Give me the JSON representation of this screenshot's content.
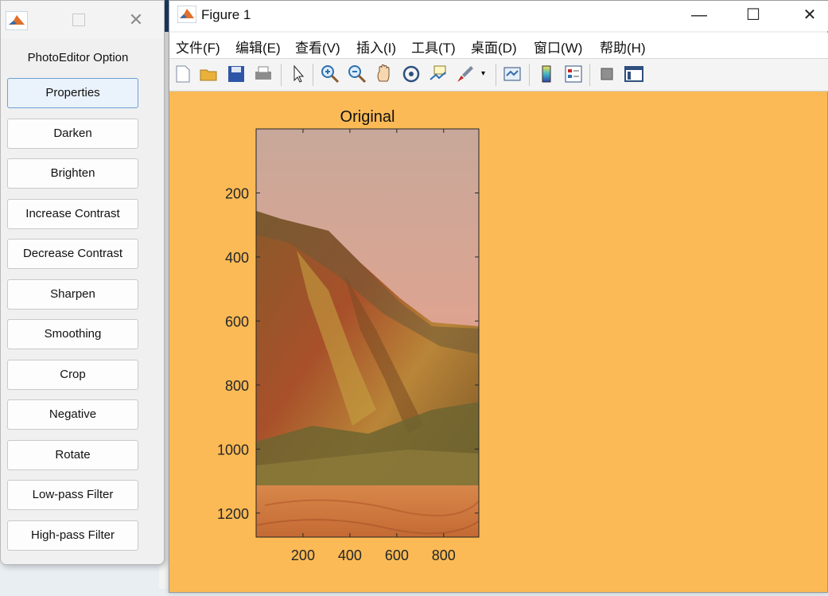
{
  "tool_window": {
    "heading": "PhotoEditor Option",
    "buttons": [
      {
        "label": "Properties"
      },
      {
        "label": "Darken"
      },
      {
        "label": "Brighten"
      },
      {
        "label": "Increase Contrast"
      },
      {
        "label": "Decrease Contrast"
      },
      {
        "label": "Sharpen"
      },
      {
        "label": "Smoothing"
      },
      {
        "label": "Crop"
      },
      {
        "label": "Negative"
      },
      {
        "label": "Rotate"
      },
      {
        "label": "Low-pass Filter"
      },
      {
        "label": "High-pass Filter"
      }
    ]
  },
  "figure_window": {
    "title": "Figure 1",
    "controls": {
      "minimize": "—",
      "maximize": "☐",
      "close": "✕"
    },
    "menu": [
      "文件(F)",
      "编辑(E)",
      "查看(V)",
      "插入(I)",
      "工具(T)",
      "桌面(D)",
      "窗口(W)",
      "帮助(H)"
    ],
    "toolbar_icons": [
      "new-figure-icon",
      "open-icon",
      "save-icon",
      "print-icon",
      "pointer-icon",
      "zoom-in-icon",
      "zoom-out-icon",
      "pan-icon",
      "rotate-3d-icon",
      "data-cursor-icon",
      "brush-icon",
      "link-plot-icon",
      "colorbar-icon",
      "legend-icon",
      "hide-plot-tools-icon",
      "show-plot-tools-icon"
    ],
    "background_color": "#fbba55"
  },
  "axes": {
    "title": "Original",
    "xticks": [
      "200",
      "400",
      "600",
      "800"
    ],
    "yticks": [
      "200",
      "400",
      "600",
      "800",
      "1000",
      "1200"
    ],
    "xlim": [
      0,
      950
    ],
    "ylim": [
      0,
      1275
    ]
  }
}
